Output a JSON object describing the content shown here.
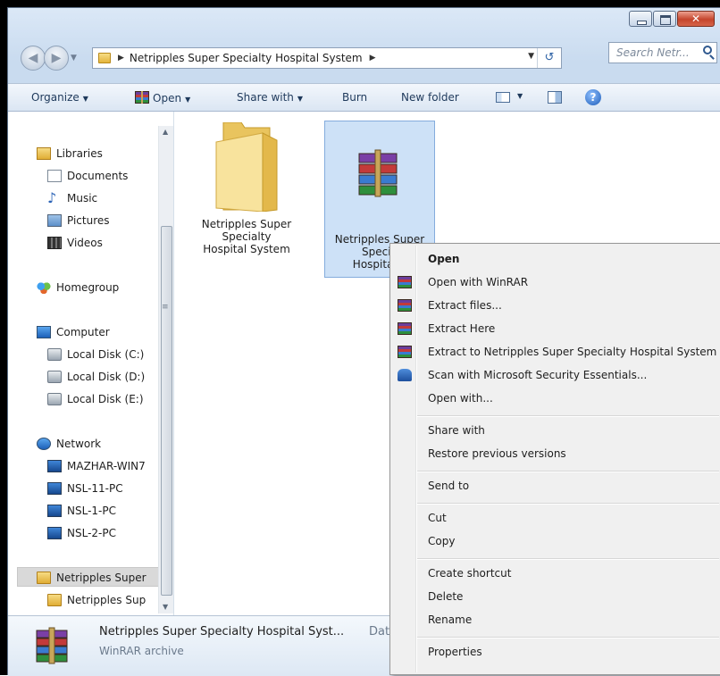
{
  "window": {
    "address_path": "Netripples Super Specialty Hospital System",
    "search_placeholder": "Search Netr..."
  },
  "toolbar": {
    "organize": "Organize",
    "open": "Open",
    "share_with": "Share with",
    "burn": "Burn",
    "new_folder": "New folder"
  },
  "sidebar": {
    "libraries": "Libraries",
    "documents": "Documents",
    "music": "Music",
    "pictures": "Pictures",
    "videos": "Videos",
    "homegroup": "Homegroup",
    "computer": "Computer",
    "disk_c": "Local Disk (C:)",
    "disk_d": "Local Disk (D:)",
    "disk_e": "Local Disk (E:)",
    "network": "Network",
    "pc1": "MAZHAR-WIN7",
    "pc2": "NSL-11-PC",
    "pc3": "NSL-1-PC",
    "pc4": "NSL-2-PC",
    "folder_sel": "Netripples Super",
    "folder_sub": "Netripples Sup"
  },
  "files": [
    {
      "name_l1": "Netripples Super",
      "name_l2": "Specialty",
      "name_l3": "Hospital System"
    },
    {
      "name_l1": "Netripples Super",
      "name_l2": "Specia",
      "name_l3": "Hospital S"
    }
  ],
  "context_menu": {
    "open": "Open",
    "open_winrar": "Open with WinRAR",
    "extract_files": "Extract files...",
    "extract_here": "Extract Here",
    "extract_to": "Extract to Netripples  Super Specialty Hospital System",
    "scan": "Scan with Microsoft Security Essentials...",
    "open_with": "Open with...",
    "share_with": "Share with",
    "restore": "Restore previous versions",
    "send_to": "Send to",
    "cut": "Cut",
    "copy": "Copy",
    "create_shortcut": "Create shortcut",
    "delete": "Delete",
    "rename": "Rename",
    "properties": "Properties"
  },
  "status": {
    "name": "Netripples  Super Specialty Hospital Syst...",
    "date_label": "Date",
    "type": "WinRAR archive"
  }
}
